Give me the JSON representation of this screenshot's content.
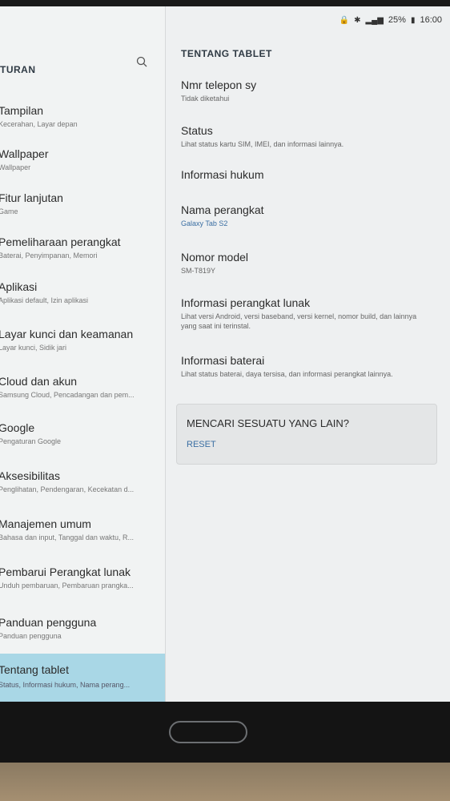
{
  "status_bar": {
    "battery": "25%",
    "time": "16:00"
  },
  "left_pane": {
    "title": "TURAN",
    "items": [
      {
        "title": "Tampilan",
        "subtitle": "Kecerahan, Layar depan"
      },
      {
        "title": "Wallpaper",
        "subtitle": "Wallpaper"
      },
      {
        "title": "Fitur lanjutan",
        "subtitle": "Game"
      },
      {
        "title": "Pemeliharaan perangkat",
        "subtitle": "Baterai, Penyimpanan, Memori"
      },
      {
        "title": "Aplikasi",
        "subtitle": "Aplikasi default, Izin aplikasi"
      },
      {
        "title": "Layar kunci dan keamanan",
        "subtitle": "Layar kunci, Sidik jari"
      },
      {
        "title": "Cloud dan akun",
        "subtitle": "Samsung Cloud, Pencadangan dan pem..."
      },
      {
        "title": "Google",
        "subtitle": "Pengaturan Google"
      },
      {
        "title": "Aksesibilitas",
        "subtitle": "Penglihatan, Pendengaran, Kecekatan d..."
      },
      {
        "title": "Manajemen umum",
        "subtitle": "Bahasa dan input, Tanggal dan waktu, R..."
      },
      {
        "title": "Pembarui Perangkat lunak",
        "subtitle": "Unduh pembaruan, Pembaruan prangka..."
      },
      {
        "title": "Panduan pengguna",
        "subtitle": "Panduan pengguna"
      },
      {
        "title": "Tentang tablet",
        "subtitle": "Status, Informasi hukum, Nama perang..."
      }
    ]
  },
  "right_pane": {
    "title": "TENTANG TABLET",
    "items": [
      {
        "title": "Nmr telepon sy",
        "subtitle": "Tidak diketahui"
      },
      {
        "title": "Status",
        "subtitle": "Lihat status kartu SIM, IMEI, dan informasi lainnya."
      },
      {
        "title": "Informasi hukum",
        "subtitle": ""
      },
      {
        "title": "Nama perangkat",
        "subtitle": "Galaxy Tab S2"
      },
      {
        "title": "Nomor model",
        "subtitle": "SM-T819Y"
      },
      {
        "title": "Informasi perangkat lunak",
        "subtitle": "Lihat versi Android, versi baseband, versi kernel, nomor build, dan lainnya yang saat ini terinstal."
      },
      {
        "title": "Informasi baterai",
        "subtitle": "Lihat status baterai, daya tersisa, dan informasi perangkat lainnya."
      }
    ],
    "card": {
      "question": "MENCARI SESUATU YANG LAIN?",
      "reset": "RESET"
    }
  },
  "colors": {
    "active_item": "#a9d7e6",
    "link": "#3b6fa3"
  }
}
